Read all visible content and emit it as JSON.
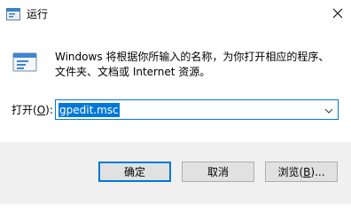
{
  "window": {
    "title": "运行",
    "close_icon": "close-icon",
    "app_icon": "run-app-icon"
  },
  "content": {
    "description": "Windows 将根据你所输入的名称，为你打开相应的程序、文件夹、文档或 Internet 资源。",
    "open_label_prefix": "打开(",
    "open_label_accel": "O",
    "open_label_suffix": "):",
    "command_value": "gpedit.msc",
    "dropdown_icon": "chevron-down-icon"
  },
  "buttons": {
    "ok_label": "确定",
    "cancel_label": "取消",
    "browse_prefix": "浏览(",
    "browse_accel": "B",
    "browse_suffix": ")..."
  },
  "colors": {
    "accent": "#0078d7",
    "footer_bg": "#f0f0f0",
    "button_bg": "#e1e1e1"
  }
}
